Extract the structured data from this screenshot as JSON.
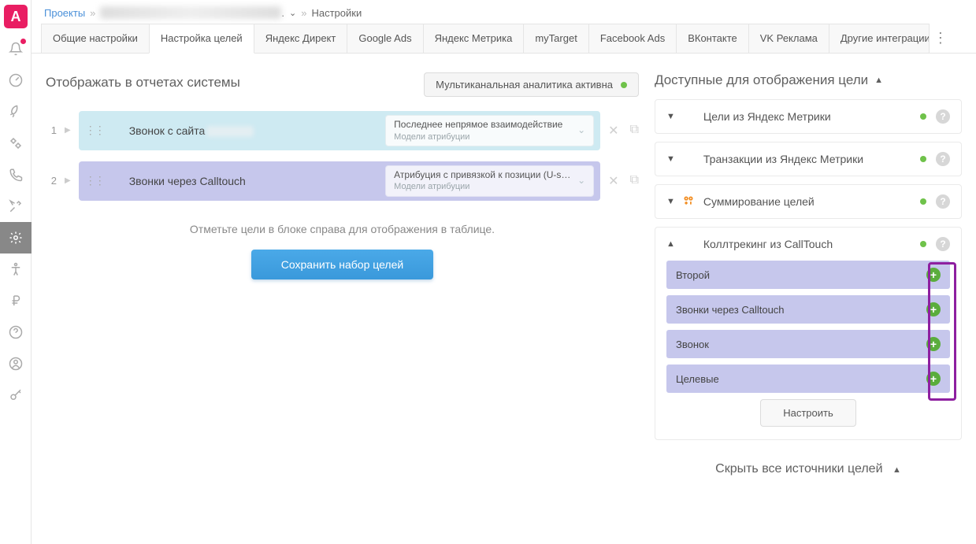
{
  "breadcrumb": {
    "projects": "Проекты",
    "current": "Настройки"
  },
  "tabs": [
    "Общие настройки",
    "Настройка целей",
    "Яндекс Директ",
    "Google Ads",
    "Яндекс Метрика",
    "myTarget",
    "Facebook Ads",
    "ВКонтакте",
    "VK Реклама",
    "Другие интеграции"
  ],
  "active_tab_index": 1,
  "left": {
    "title": "Отображать в отчетах системы",
    "status_chip": "Мультиканальная аналитика активна",
    "rows": [
      {
        "num": "1",
        "name": "Звонок с сайта",
        "attr_main": "Последнее непрямое взаимодействие",
        "attr_sub": "Модели атрибуции"
      },
      {
        "num": "2",
        "name": "Звонки через Calltouch",
        "attr_main": "Атрибуция с привязкой к позиции (U-s…",
        "attr_sub": "Модели атрибуции"
      }
    ],
    "hint": "Отметьте цели в блоке справа для отображения в таблице.",
    "save": "Сохранить набор целей"
  },
  "right": {
    "title": "Доступные для отображения цели",
    "panels": [
      {
        "title": "Цели из Яндекс Метрики",
        "expanded": false,
        "icon": "metrika"
      },
      {
        "title": "Транзакции из Яндекс Метрики",
        "expanded": false,
        "icon": "metrika"
      },
      {
        "title": "Суммирование целей",
        "expanded": false,
        "icon": "sum"
      },
      {
        "title": "Коллтрекинг из CallTouch",
        "expanded": true,
        "icon": "calltouch",
        "items": [
          "Второй",
          "Звонки через Calltouch",
          "Звонок",
          "Целевые"
        ],
        "configure": "Настроить"
      }
    ],
    "hide_all": "Скрыть все источники целей"
  }
}
